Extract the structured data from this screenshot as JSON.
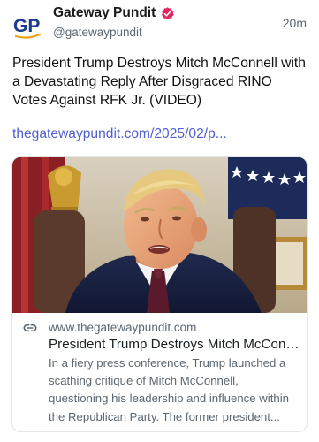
{
  "post": {
    "author": {
      "display_name": "Gateway Pundit",
      "handle": "@gatewaypundit",
      "avatar_text": "GP",
      "verified": true
    },
    "timestamp": "20m",
    "text": "President Trump Destroys Mitch McConnell with a Devastating Reply After Disgraced RINO Votes Against RFK Jr. (VIDEO)",
    "link_text": "thegatewaypundit.com/2025/02/p...",
    "card": {
      "domain": "www.thegatewaypundit.com",
      "title": "President Trump Destroys Mitch McConnell with a Devastating Reply After Disgraced RINO Votes Against RFK Jr. (VIDEO)",
      "description": "In a fiery press conference, Trump launched a scathing critique of Mitch McConnell, questioning his leadership and influence within the Republican Party. The former president..."
    }
  },
  "colors": {
    "link": "#4f5fd0",
    "verified_badge": "#e0245e",
    "avatar_blue": "#1e3a8a",
    "avatar_gold": "#e8a317"
  },
  "icons": {
    "verified": "verified-badge-icon",
    "link": "link-icon"
  }
}
